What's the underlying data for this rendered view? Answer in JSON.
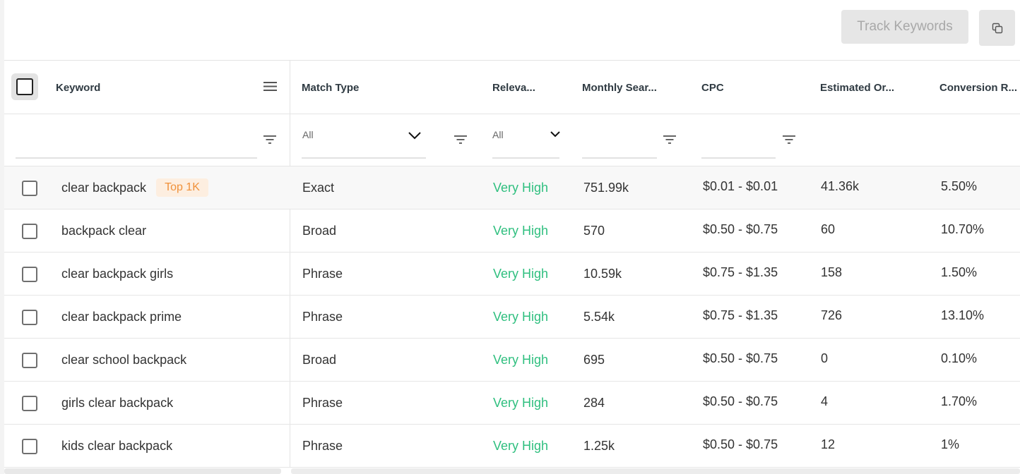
{
  "toolbar": {
    "track_label": "Track Keywords",
    "copy_icon": "copy-icon"
  },
  "columns": {
    "keyword": "Keyword",
    "match_type": "Match Type",
    "relevance": "Releva...",
    "monthly_search": "Monthly Sear...",
    "cpc": "CPC",
    "estimated_orders": "Estimated Or...",
    "conversion_rate": "Conversion R..."
  },
  "filters": {
    "match_type_value": "All",
    "relevance_value": "All"
  },
  "rows": [
    {
      "keyword": "clear backpack",
      "badge": "Top 1K",
      "match_type": "Exact",
      "relevance": "Very High",
      "monthly_search": "751.99k",
      "cpc": "$0.01 - $0.01",
      "estimated_orders": "41.36k",
      "conversion_rate": "5.50%"
    },
    {
      "keyword": "backpack clear",
      "badge": "",
      "match_type": "Broad",
      "relevance": "Very High",
      "monthly_search": "570",
      "cpc": "$0.50 - $0.75",
      "estimated_orders": "60",
      "conversion_rate": "10.70%"
    },
    {
      "keyword": "clear backpack girls",
      "badge": "",
      "match_type": "Phrase",
      "relevance": "Very High",
      "monthly_search": "10.59k",
      "cpc": "$0.75 - $1.35",
      "estimated_orders": "158",
      "conversion_rate": "1.50%"
    },
    {
      "keyword": "clear backpack prime",
      "badge": "",
      "match_type": "Phrase",
      "relevance": "Very High",
      "monthly_search": "5.54k",
      "cpc": "$0.75 - $1.35",
      "estimated_orders": "726",
      "conversion_rate": "13.10%"
    },
    {
      "keyword": "clear school backpack",
      "badge": "",
      "match_type": "Broad",
      "relevance": "Very High",
      "monthly_search": "695",
      "cpc": "$0.50 - $0.75",
      "estimated_orders": "0",
      "conversion_rate": "0.10%"
    },
    {
      "keyword": "girls clear backpack",
      "badge": "",
      "match_type": "Phrase",
      "relevance": "Very High",
      "monthly_search": "284",
      "cpc": "$0.50 - $0.75",
      "estimated_orders": "4",
      "conversion_rate": "1.70%"
    },
    {
      "keyword": "kids clear backpack",
      "badge": "",
      "match_type": "Phrase",
      "relevance": "Very High",
      "monthly_search": "1.25k",
      "cpc": "$0.50 - $0.75",
      "estimated_orders": "12",
      "conversion_rate": "1%"
    }
  ],
  "colors": {
    "relevance_high": "#2fbf7f",
    "badge_text": "#f0913a",
    "badge_bg": "#fdeee0"
  }
}
